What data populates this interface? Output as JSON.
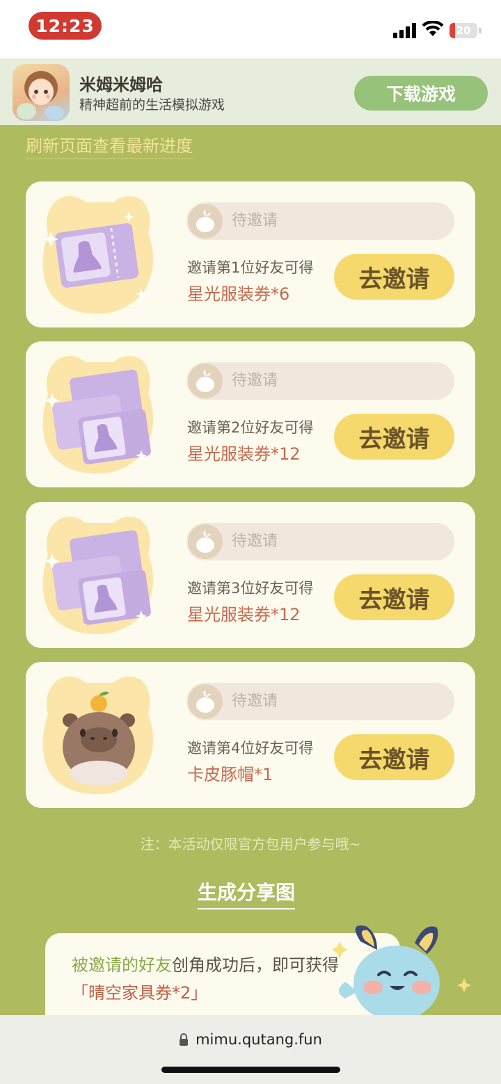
{
  "status_bar": {
    "time": "12:23",
    "battery": "20",
    "battery_level": 0.2
  },
  "app_banner": {
    "name": "米姆米姆哈",
    "tagline": "精神超前的生活模拟游戏",
    "download_label": "下载游戏"
  },
  "refresh_label": "刷新页面查看最新进度",
  "status_pending": "待邀请",
  "invite_label": "去邀请",
  "rewards": [
    {
      "condition": "邀请第1位好友可得",
      "reward": "星光服装券*6"
    },
    {
      "condition": "邀请第2位好友可得",
      "reward": "星光服装券*12"
    },
    {
      "condition": "邀请第3位好友可得",
      "reward": "星光服装券*12"
    },
    {
      "condition": "邀请第4位好友可得",
      "reward": "卡皮豚帽*1"
    }
  ],
  "note": "注：本活动仅限官方包用户参与哦~",
  "share_label": "生成分享图",
  "friend_reward": {
    "part1": "被邀请的好友",
    "part2": "创角成功后，即可获得",
    "part3": "「晴空家具券*2」"
  },
  "url": "mimu.qutang.fun",
  "colors": {
    "background": "#afbb5f",
    "invite_button": "#f5d96c",
    "download_button": "#97c27a",
    "reward_text": "#c66a4e"
  }
}
